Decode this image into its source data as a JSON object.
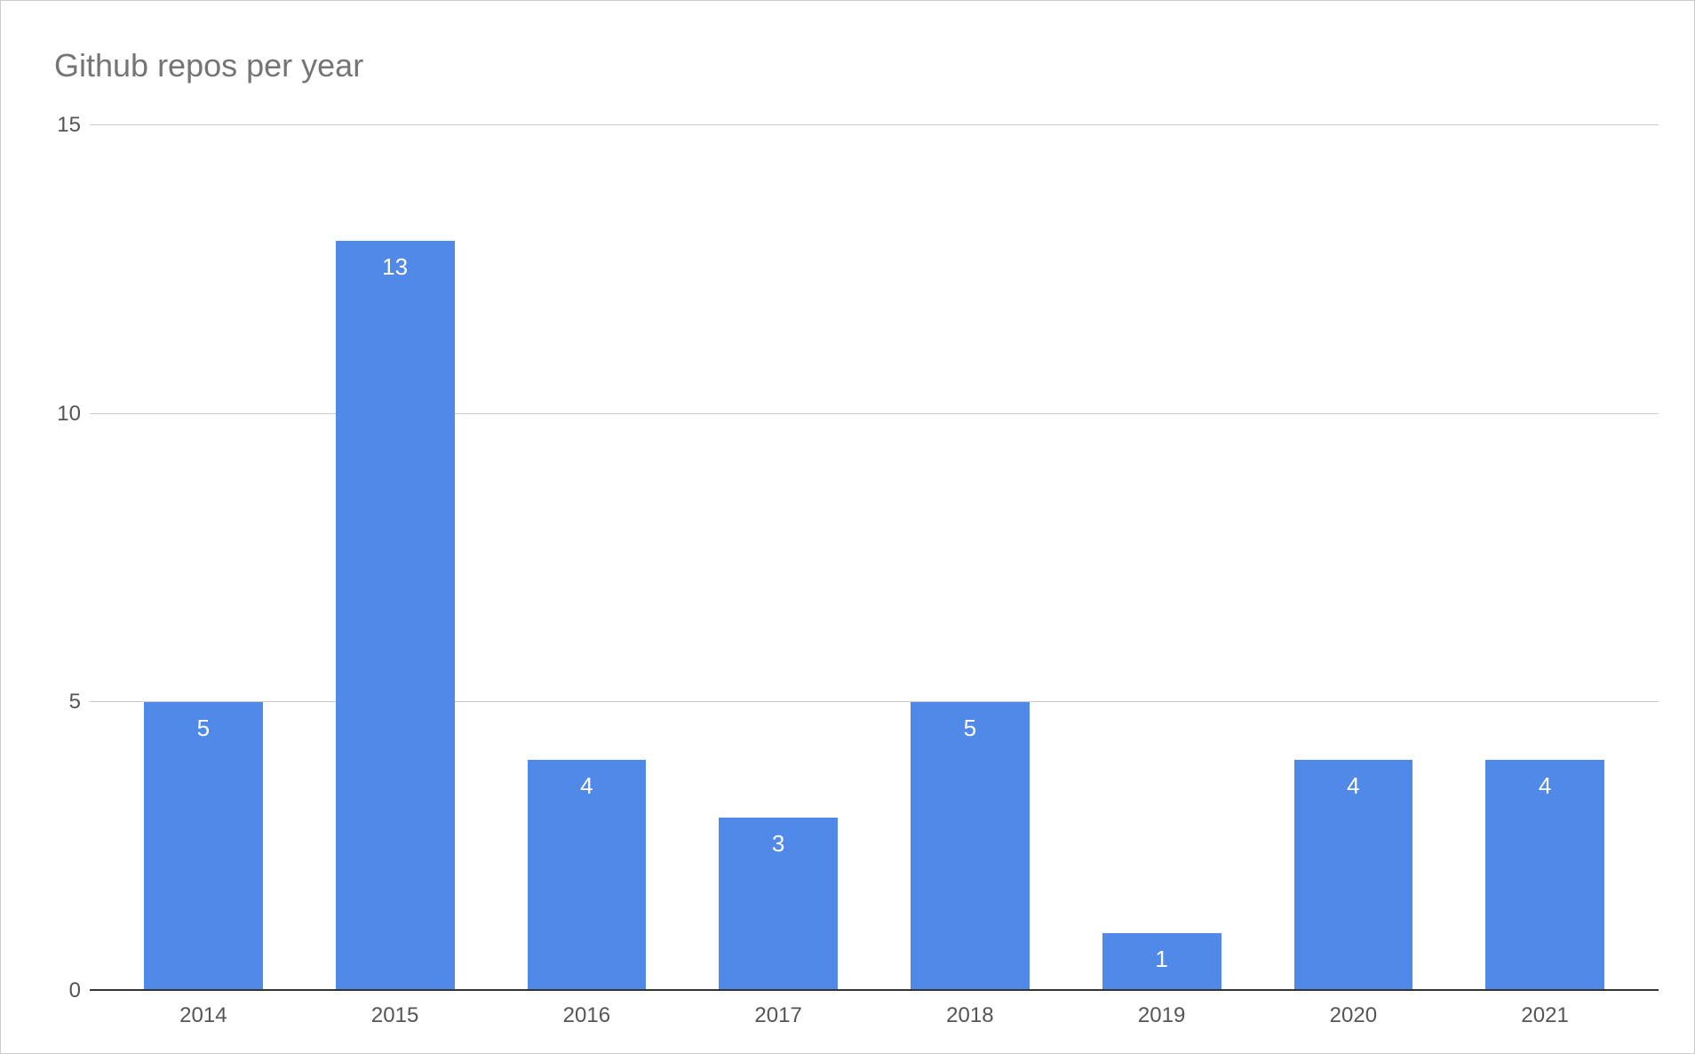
{
  "chart_data": {
    "type": "bar",
    "title": "Github repos per year",
    "categories": [
      "2014",
      "2015",
      "2016",
      "2017",
      "2018",
      "2019",
      "2020",
      "2021"
    ],
    "values": [
      5,
      13,
      4,
      3,
      5,
      1,
      4,
      4
    ],
    "xlabel": "",
    "ylabel": "",
    "ylim": [
      0,
      15
    ],
    "y_ticks": [
      0,
      5,
      10,
      15
    ],
    "bar_color": "#5189e8",
    "grid": true
  }
}
